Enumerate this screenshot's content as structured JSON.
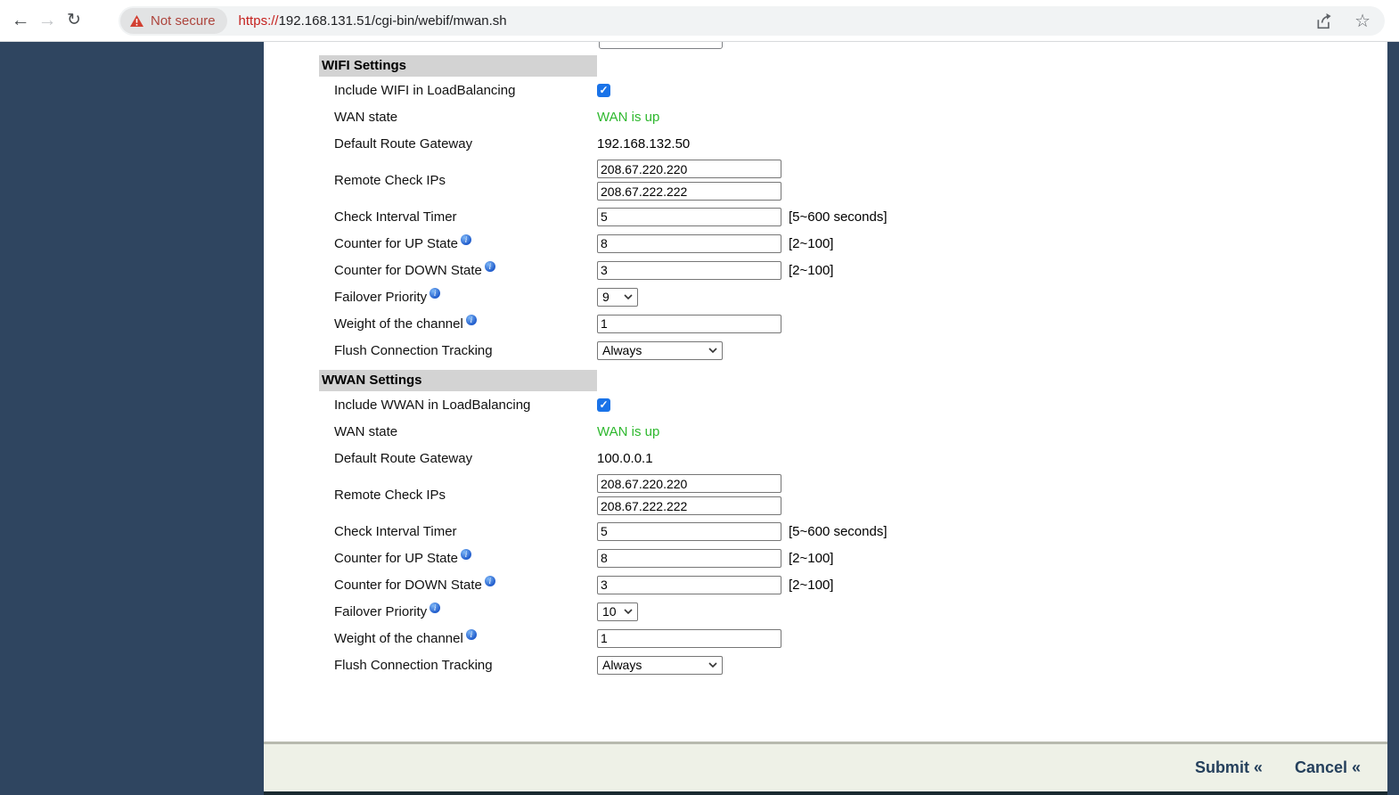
{
  "browser": {
    "back_icon": "←",
    "forward_icon": "→",
    "reload_icon": "↻",
    "not_secure_label": "Not secure",
    "url_scheme": "https://",
    "url_rest": "192.168.131.51/cgi-bin/webif/mwan.sh",
    "star_icon": "☆"
  },
  "icons": {
    "check": "✓",
    "warning_triangle": "alert-red-triangle",
    "share": "share-arrow",
    "info": "i"
  },
  "colors": {
    "accent_blue": "#1a73e8",
    "status_green": "#2eb82e",
    "alert_red": "#c5221f",
    "navy_background": "#2f4560",
    "section_header_gray": "#d3d3d3",
    "footer_background": "#eef1e7"
  },
  "sections": [
    {
      "title": "WIFI Settings",
      "include_label": "Include WIFI in LoadBalancing",
      "include_checked": true,
      "wan_state_label": "WAN state",
      "wan_state_value": "WAN is up",
      "gateway_label": "Default Route Gateway",
      "gateway_value": "192.168.132.50",
      "remote_ips_label": "Remote Check IPs",
      "remote_ip_1": "208.67.220.220",
      "remote_ip_2": "208.67.222.222",
      "interval_label": "Check Interval Timer",
      "interval_value": "5",
      "interval_hint": "[5~600 seconds]",
      "up_label": "Counter for UP State",
      "up_value": "8",
      "up_hint": "[2~100]",
      "down_label": "Counter for DOWN State",
      "down_value": "3",
      "down_hint": "[2~100]",
      "priority_label": "Failover Priority",
      "priority_value": "9",
      "weight_label": "Weight of the channel",
      "weight_value": "1",
      "flush_label": "Flush Connection Tracking",
      "flush_value": "Always"
    },
    {
      "title": "WWAN Settings",
      "include_label": "Include WWAN in LoadBalancing",
      "include_checked": true,
      "wan_state_label": "WAN state",
      "wan_state_value": "WAN is up",
      "gateway_label": "Default Route Gateway",
      "gateway_value": "100.0.0.1",
      "remote_ips_label": "Remote Check IPs",
      "remote_ip_1": "208.67.220.220",
      "remote_ip_2": "208.67.222.222",
      "interval_label": "Check Interval Timer",
      "interval_value": "5",
      "interval_hint": "[5~600 seconds]",
      "up_label": "Counter for UP State",
      "up_value": "8",
      "up_hint": "[2~100]",
      "down_label": "Counter for DOWN State",
      "down_value": "3",
      "down_hint": "[2~100]",
      "priority_label": "Failover Priority",
      "priority_value": "10",
      "weight_label": "Weight of the channel",
      "weight_value": "1",
      "flush_label": "Flush Connection Tracking",
      "flush_value": "Always"
    }
  ],
  "footer": {
    "submit_label": "Submit «",
    "cancel_label": "Cancel «"
  }
}
